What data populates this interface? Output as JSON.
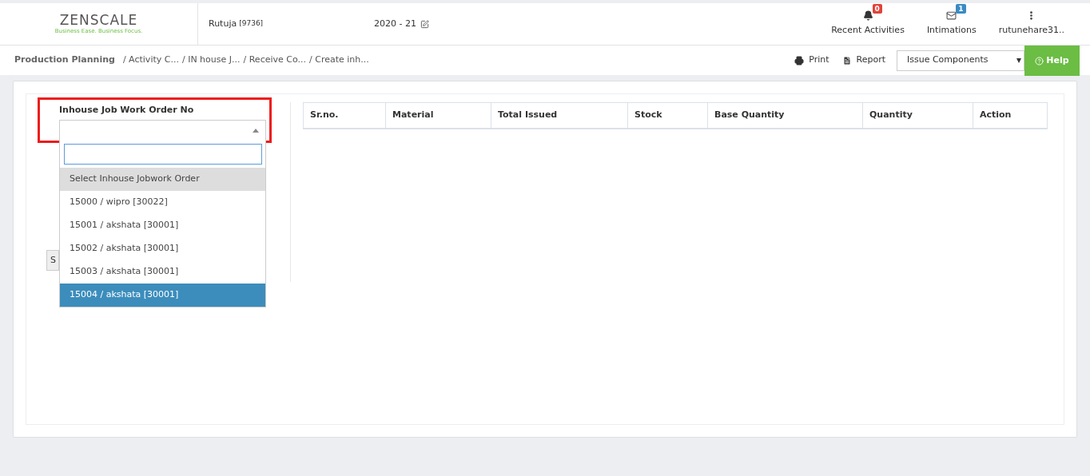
{
  "header": {
    "logo": {
      "name": "ZENSCALE",
      "tagline": "Business Ease. Business Focus."
    },
    "user": "Rutuja",
    "user_code": "[9736]",
    "year": "2020 - 21",
    "actions": [
      {
        "kind": "bell",
        "label": "Recent Activities",
        "badge": "0",
        "color": "#e0433a"
      },
      {
        "kind": "mail",
        "label": "Intimations",
        "badge": "1",
        "color": "#3a8bc4"
      },
      {
        "kind": "menu",
        "label": "rutunehare31.."
      }
    ]
  },
  "breadcrumb": [
    "Production Planning",
    "/ Activity C...",
    "/ IN house J...",
    "/ Receive Co...",
    "/ Create inh..."
  ],
  "toolbar": {
    "print": "Print",
    "report": "Report",
    "view_select": "Issue Components",
    "help": "Help"
  },
  "form": {
    "label": "Inhouse Job Work Order No",
    "highlighted": true,
    "expanded": true,
    "hidden_button": "S",
    "options": [
      {
        "kind": "placeholder",
        "label": "Select Inhouse Jobwork Order",
        "selected": false
      },
      {
        "kind": "option",
        "label": "15000 / wipro [30022]",
        "selected": false
      },
      {
        "kind": "option",
        "label": "15001 / akshata [30001]",
        "selected": false
      },
      {
        "kind": "option",
        "label": "15002 / akshata [30001]",
        "selected": false
      },
      {
        "kind": "option",
        "label": "15003 / akshata [30001]",
        "selected": false
      },
      {
        "kind": "option",
        "label": "15004 / akshata [30001]",
        "selected": true
      }
    ]
  },
  "table": {
    "columns": [
      "Sr.no.",
      "Material",
      "Total Issued",
      "Stock",
      "Base Quantity",
      "Quantity",
      "Action"
    ]
  }
}
